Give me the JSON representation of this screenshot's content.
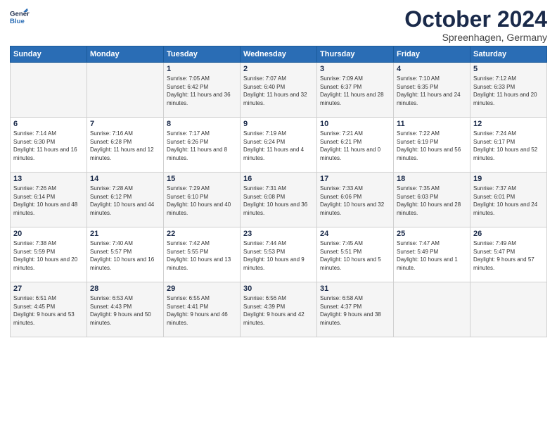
{
  "header": {
    "logo_line1": "General",
    "logo_line2": "Blue",
    "title": "October 2024",
    "subtitle": "Spreenhagen, Germany"
  },
  "days_of_week": [
    "Sunday",
    "Monday",
    "Tuesday",
    "Wednesday",
    "Thursday",
    "Friday",
    "Saturday"
  ],
  "weeks": [
    [
      {
        "num": "",
        "sunrise": "",
        "sunset": "",
        "daylight": ""
      },
      {
        "num": "",
        "sunrise": "",
        "sunset": "",
        "daylight": ""
      },
      {
        "num": "1",
        "sunrise": "Sunrise: 7:05 AM",
        "sunset": "Sunset: 6:42 PM",
        "daylight": "Daylight: 11 hours and 36 minutes."
      },
      {
        "num": "2",
        "sunrise": "Sunrise: 7:07 AM",
        "sunset": "Sunset: 6:40 PM",
        "daylight": "Daylight: 11 hours and 32 minutes."
      },
      {
        "num": "3",
        "sunrise": "Sunrise: 7:09 AM",
        "sunset": "Sunset: 6:37 PM",
        "daylight": "Daylight: 11 hours and 28 minutes."
      },
      {
        "num": "4",
        "sunrise": "Sunrise: 7:10 AM",
        "sunset": "Sunset: 6:35 PM",
        "daylight": "Daylight: 11 hours and 24 minutes."
      },
      {
        "num": "5",
        "sunrise": "Sunrise: 7:12 AM",
        "sunset": "Sunset: 6:33 PM",
        "daylight": "Daylight: 11 hours and 20 minutes."
      }
    ],
    [
      {
        "num": "6",
        "sunrise": "Sunrise: 7:14 AM",
        "sunset": "Sunset: 6:30 PM",
        "daylight": "Daylight: 11 hours and 16 minutes."
      },
      {
        "num": "7",
        "sunrise": "Sunrise: 7:16 AM",
        "sunset": "Sunset: 6:28 PM",
        "daylight": "Daylight: 11 hours and 12 minutes."
      },
      {
        "num": "8",
        "sunrise": "Sunrise: 7:17 AM",
        "sunset": "Sunset: 6:26 PM",
        "daylight": "Daylight: 11 hours and 8 minutes."
      },
      {
        "num": "9",
        "sunrise": "Sunrise: 7:19 AM",
        "sunset": "Sunset: 6:24 PM",
        "daylight": "Daylight: 11 hours and 4 minutes."
      },
      {
        "num": "10",
        "sunrise": "Sunrise: 7:21 AM",
        "sunset": "Sunset: 6:21 PM",
        "daylight": "Daylight: 11 hours and 0 minutes."
      },
      {
        "num": "11",
        "sunrise": "Sunrise: 7:22 AM",
        "sunset": "Sunset: 6:19 PM",
        "daylight": "Daylight: 10 hours and 56 minutes."
      },
      {
        "num": "12",
        "sunrise": "Sunrise: 7:24 AM",
        "sunset": "Sunset: 6:17 PM",
        "daylight": "Daylight: 10 hours and 52 minutes."
      }
    ],
    [
      {
        "num": "13",
        "sunrise": "Sunrise: 7:26 AM",
        "sunset": "Sunset: 6:14 PM",
        "daylight": "Daylight: 10 hours and 48 minutes."
      },
      {
        "num": "14",
        "sunrise": "Sunrise: 7:28 AM",
        "sunset": "Sunset: 6:12 PM",
        "daylight": "Daylight: 10 hours and 44 minutes."
      },
      {
        "num": "15",
        "sunrise": "Sunrise: 7:29 AM",
        "sunset": "Sunset: 6:10 PM",
        "daylight": "Daylight: 10 hours and 40 minutes."
      },
      {
        "num": "16",
        "sunrise": "Sunrise: 7:31 AM",
        "sunset": "Sunset: 6:08 PM",
        "daylight": "Daylight: 10 hours and 36 minutes."
      },
      {
        "num": "17",
        "sunrise": "Sunrise: 7:33 AM",
        "sunset": "Sunset: 6:06 PM",
        "daylight": "Daylight: 10 hours and 32 minutes."
      },
      {
        "num": "18",
        "sunrise": "Sunrise: 7:35 AM",
        "sunset": "Sunset: 6:03 PM",
        "daylight": "Daylight: 10 hours and 28 minutes."
      },
      {
        "num": "19",
        "sunrise": "Sunrise: 7:37 AM",
        "sunset": "Sunset: 6:01 PM",
        "daylight": "Daylight: 10 hours and 24 minutes."
      }
    ],
    [
      {
        "num": "20",
        "sunrise": "Sunrise: 7:38 AM",
        "sunset": "Sunset: 5:59 PM",
        "daylight": "Daylight: 10 hours and 20 minutes."
      },
      {
        "num": "21",
        "sunrise": "Sunrise: 7:40 AM",
        "sunset": "Sunset: 5:57 PM",
        "daylight": "Daylight: 10 hours and 16 minutes."
      },
      {
        "num": "22",
        "sunrise": "Sunrise: 7:42 AM",
        "sunset": "Sunset: 5:55 PM",
        "daylight": "Daylight: 10 hours and 13 minutes."
      },
      {
        "num": "23",
        "sunrise": "Sunrise: 7:44 AM",
        "sunset": "Sunset: 5:53 PM",
        "daylight": "Daylight: 10 hours and 9 minutes."
      },
      {
        "num": "24",
        "sunrise": "Sunrise: 7:45 AM",
        "sunset": "Sunset: 5:51 PM",
        "daylight": "Daylight: 10 hours and 5 minutes."
      },
      {
        "num": "25",
        "sunrise": "Sunrise: 7:47 AM",
        "sunset": "Sunset: 5:49 PM",
        "daylight": "Daylight: 10 hours and 1 minute."
      },
      {
        "num": "26",
        "sunrise": "Sunrise: 7:49 AM",
        "sunset": "Sunset: 5:47 PM",
        "daylight": "Daylight: 9 hours and 57 minutes."
      }
    ],
    [
      {
        "num": "27",
        "sunrise": "Sunrise: 6:51 AM",
        "sunset": "Sunset: 4:45 PM",
        "daylight": "Daylight: 9 hours and 53 minutes."
      },
      {
        "num": "28",
        "sunrise": "Sunrise: 6:53 AM",
        "sunset": "Sunset: 4:43 PM",
        "daylight": "Daylight: 9 hours and 50 minutes."
      },
      {
        "num": "29",
        "sunrise": "Sunrise: 6:55 AM",
        "sunset": "Sunset: 4:41 PM",
        "daylight": "Daylight: 9 hours and 46 minutes."
      },
      {
        "num": "30",
        "sunrise": "Sunrise: 6:56 AM",
        "sunset": "Sunset: 4:39 PM",
        "daylight": "Daylight: 9 hours and 42 minutes."
      },
      {
        "num": "31",
        "sunrise": "Sunrise: 6:58 AM",
        "sunset": "Sunset: 4:37 PM",
        "daylight": "Daylight: 9 hours and 38 minutes."
      },
      {
        "num": "",
        "sunrise": "",
        "sunset": "",
        "daylight": ""
      },
      {
        "num": "",
        "sunrise": "",
        "sunset": "",
        "daylight": ""
      }
    ]
  ]
}
